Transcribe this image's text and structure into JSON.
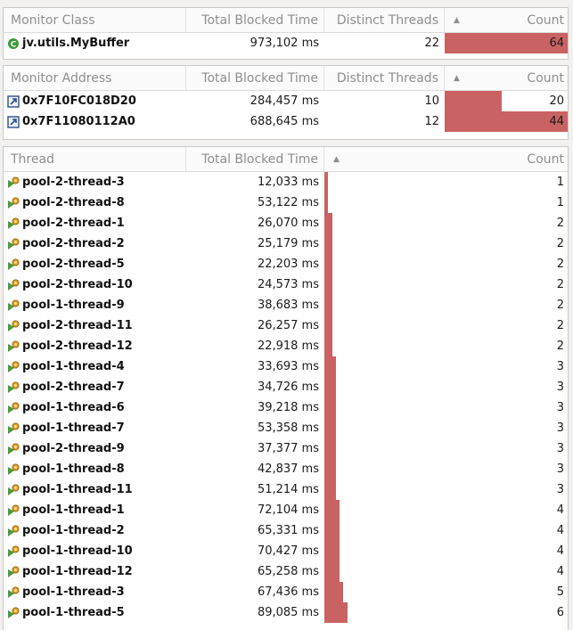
{
  "colors": {
    "bar": "#c96262",
    "header_text": "#8e8e8e",
    "class_icon": "#3c9a3c",
    "address_icon": "#2b4f8a",
    "thread_icon": "#e0a020"
  },
  "monitor_class_table": {
    "headers": {
      "name": "Monitor Class",
      "blocked": "Total Blocked Time",
      "threads": "Distinct Threads",
      "sort_indicator": "▲",
      "count": "Count"
    },
    "rows": [
      {
        "icon": "class-icon",
        "name": "jv.utils.MyBuffer",
        "blocked": "973,102 ms",
        "threads": "22",
        "count": 64
      }
    ]
  },
  "monitor_address_table": {
    "headers": {
      "name": "Monitor Address",
      "blocked": "Total Blocked Time",
      "threads": "Distinct Threads",
      "sort_indicator": "▲",
      "count": "Count"
    },
    "rows": [
      {
        "icon": "address-icon",
        "name": "0x7F10FC018D20",
        "blocked": "284,457 ms",
        "threads": "10",
        "count": 20
      },
      {
        "icon": "address-icon",
        "name": "0x7F11080112A0",
        "blocked": "688,645 ms",
        "threads": "12",
        "count": 44
      }
    ]
  },
  "thread_table": {
    "headers": {
      "name": "Thread",
      "blocked": "Total Blocked Time",
      "sort_indicator": "▲",
      "count": "Count"
    },
    "rows": [
      {
        "name": "pool-2-thread-3",
        "blocked": "12,033 ms",
        "count": 1
      },
      {
        "name": "pool-2-thread-8",
        "blocked": "53,122 ms",
        "count": 1
      },
      {
        "name": "pool-2-thread-1",
        "blocked": "26,070 ms",
        "count": 2
      },
      {
        "name": "pool-2-thread-2",
        "blocked": "25,179 ms",
        "count": 2
      },
      {
        "name": "pool-2-thread-5",
        "blocked": "22,203 ms",
        "count": 2
      },
      {
        "name": "pool-2-thread-10",
        "blocked": "24,573 ms",
        "count": 2
      },
      {
        "name": "pool-1-thread-9",
        "blocked": "38,683 ms",
        "count": 2
      },
      {
        "name": "pool-2-thread-11",
        "blocked": "26,257 ms",
        "count": 2
      },
      {
        "name": "pool-2-thread-12",
        "blocked": "22,918 ms",
        "count": 2
      },
      {
        "name": "pool-1-thread-4",
        "blocked": "33,693 ms",
        "count": 3
      },
      {
        "name": "pool-2-thread-7",
        "blocked": "34,726 ms",
        "count": 3
      },
      {
        "name": "pool-1-thread-6",
        "blocked": "39,218 ms",
        "count": 3
      },
      {
        "name": "pool-1-thread-7",
        "blocked": "53,358 ms",
        "count": 3
      },
      {
        "name": "pool-2-thread-9",
        "blocked": "37,377 ms",
        "count": 3
      },
      {
        "name": "pool-1-thread-8",
        "blocked": "42,837 ms",
        "count": 3
      },
      {
        "name": "pool-1-thread-11",
        "blocked": "51,214 ms",
        "count": 3
      },
      {
        "name": "pool-1-thread-1",
        "blocked": "72,104 ms",
        "count": 4
      },
      {
        "name": "pool-1-thread-2",
        "blocked": "65,331 ms",
        "count": 4
      },
      {
        "name": "pool-1-thread-10",
        "blocked": "70,427 ms",
        "count": 4
      },
      {
        "name": "pool-1-thread-12",
        "blocked": "65,258 ms",
        "count": 4
      },
      {
        "name": "pool-1-thread-3",
        "blocked": "67,436 ms",
        "count": 5
      },
      {
        "name": "pool-1-thread-5",
        "blocked": "89,085 ms",
        "count": 6
      }
    ]
  }
}
